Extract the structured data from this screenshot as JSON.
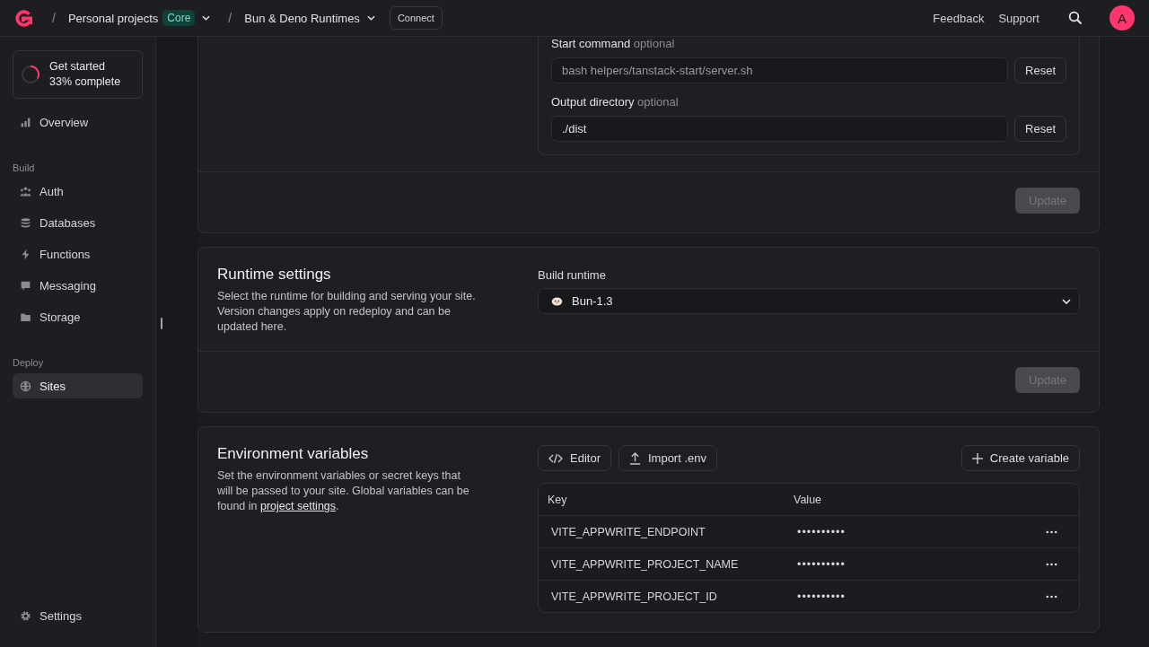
{
  "header": {
    "breadcrumbs": [
      {
        "separator": "/",
        "label": "Personal projects",
        "badge": "Core"
      },
      {
        "separator": "/",
        "label": "Bun & Deno Runtimes"
      }
    ],
    "connect_button": "Connect",
    "links": [
      "Feedback",
      "Support"
    ],
    "avatar": "A"
  },
  "sidebar": {
    "progress": {
      "title": "Get started",
      "subtitle": "33% complete",
      "level": 0.33
    },
    "sections": [
      {
        "items": [
          {
            "label": "Overview",
            "selected": false
          }
        ]
      },
      {
        "title": "Build",
        "items": [
          {
            "label": "Auth",
            "selected": false
          },
          {
            "label": "Databases",
            "selected": false
          },
          {
            "label": "Functions",
            "selected": false
          },
          {
            "label": "Messaging",
            "selected": false
          },
          {
            "label": "Storage",
            "selected": false
          }
        ]
      },
      {
        "title": "Deploy",
        "items": [
          {
            "label": "Sites",
            "selected": true
          }
        ]
      }
    ],
    "footer_item": {
      "label": "Settings",
      "selected": false
    }
  },
  "build_settings": {
    "fields": [
      {
        "label": "Start command",
        "hint": "optional",
        "placeholder": "bash helpers/tanstack-start/server.sh",
        "reset": "Reset"
      },
      {
        "label": "Output directory",
        "hint": "optional",
        "value": "./dist",
        "reset": "Reset"
      }
    ],
    "update_button": {
      "label": "Update",
      "disabled": true
    }
  },
  "runtime_settings": {
    "title": "Runtime settings",
    "description": "Select the runtime for building and serving your site. Version changes apply on redeploy and can be updated here.",
    "field_label": "Build runtime",
    "value": "Bun-1.3",
    "update_button": {
      "label": "Update",
      "disabled": true
    }
  },
  "environment_variables": {
    "title": "Environment variables",
    "description_before": "Set the environment variables or secret keys that will be passed to your site. Global variables can be found in ",
    "link": "project settings",
    "description_after": ".",
    "buttons": [
      {
        "label": "Editor"
      },
      {
        "label": "Import .env"
      }
    ],
    "create_button": "Create variable",
    "columns": [
      "Key",
      "Value"
    ],
    "rows": [
      {
        "key": "VITE_APPWRITE_ENDPOINT",
        "value": "••••••••••"
      },
      {
        "key": "VITE_APPWRITE_PROJECT_NAME",
        "value": "••••••••••"
      },
      {
        "key": "VITE_APPWRITE_PROJECT_ID",
        "value": "••••••••••"
      }
    ]
  }
}
